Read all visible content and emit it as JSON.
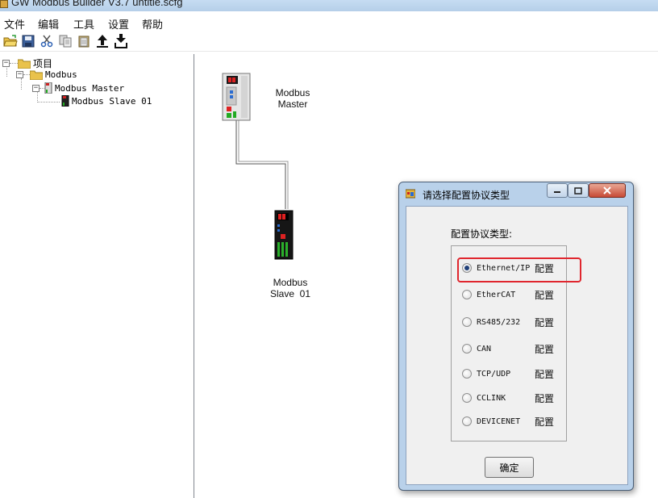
{
  "window": {
    "title": "GW Modbus Builder V3.7   untitle.scfg"
  },
  "menu": [
    "文件",
    "编辑",
    "工具",
    "设置",
    "帮助"
  ],
  "toolbar": [
    "open-folder-icon",
    "save-icon",
    "cut-icon",
    "copy-icon",
    "paste-icon",
    "upload-icon",
    "download-icon"
  ],
  "tree": {
    "root": "项目",
    "modbus": "Modbus",
    "master": "Modbus Master",
    "slave": "Modbus Slave  01"
  },
  "canvas": {
    "master_label": [
      "Modbus",
      "Master"
    ],
    "slave_label": [
      "Modbus",
      "Slave  01"
    ]
  },
  "dialog": {
    "title": "请选择配置协议类型",
    "group_label": "配置协议类型:",
    "options": [
      {
        "name": "Ethernet/IP",
        "suffix": "配置",
        "checked": true,
        "highlighted": true
      },
      {
        "name": "EtherCAT",
        "suffix": "配置",
        "checked": false
      },
      {
        "name": "RS485/232",
        "suffix": "配置",
        "checked": false
      },
      {
        "name": "CAN",
        "suffix": "配置",
        "checked": false
      },
      {
        "name": "TCP/UDP",
        "suffix": "配置",
        "checked": false
      },
      {
        "name": "CCLINK",
        "suffix": "配置",
        "checked": false
      },
      {
        "name": "DEVICENET",
        "suffix": "配置",
        "checked": false
      }
    ],
    "ok_label": "确定"
  },
  "colors": {
    "dialog_frame": "#b9d1ea",
    "highlight": "#e0262e"
  }
}
